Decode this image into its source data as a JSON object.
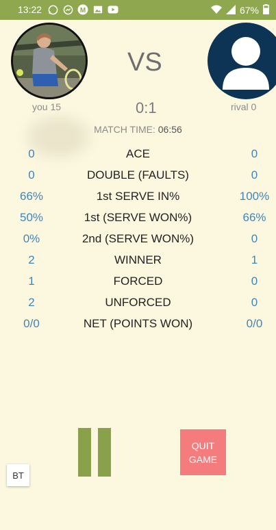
{
  "status_bar": {
    "time": "13:22",
    "battery": "67%",
    "icons": [
      "whatsapp-icon",
      "messenger-icon",
      "gmail-m-icon",
      "image-icon",
      "youtube-icon"
    ]
  },
  "header": {
    "vs": "VS",
    "you_label": "you 15",
    "score": "0:1",
    "rival_label": "rival 0"
  },
  "match_time": {
    "label": "MATCH TIME:",
    "value": "06:56"
  },
  "stats": [
    {
      "you": "0",
      "name": "ACE",
      "rival": "0"
    },
    {
      "you": "0",
      "name": "DOUBLE (FAULTS)",
      "rival": "0"
    },
    {
      "you": "66%",
      "name": "1st SERVE IN%",
      "rival": "100%"
    },
    {
      "you": "50%",
      "name": "1st (SERVE WON%)",
      "rival": "66%"
    },
    {
      "you": "0%",
      "name": "2nd (SERVE WON%)",
      "rival": "0"
    },
    {
      "you": "2",
      "name": "WINNER",
      "rival": "1"
    },
    {
      "you": "1",
      "name": "FORCED",
      "rival": "0"
    },
    {
      "you": "2",
      "name": "UNFORCED",
      "rival": "0"
    },
    {
      "you": "0/0",
      "name": "NET (POINTS WON)",
      "rival": "0/0"
    }
  ],
  "controls": {
    "quit_line1": "QUIT",
    "quit_line2": "GAME",
    "bt_label": "BT"
  },
  "colors": {
    "status_bar": "#8fa84f",
    "background": "#fcf8e0",
    "stat_value": "#3f85b8",
    "pause": "#8aa14c",
    "quit": "#f47c7c",
    "rival_avatar": "#0d3355"
  }
}
